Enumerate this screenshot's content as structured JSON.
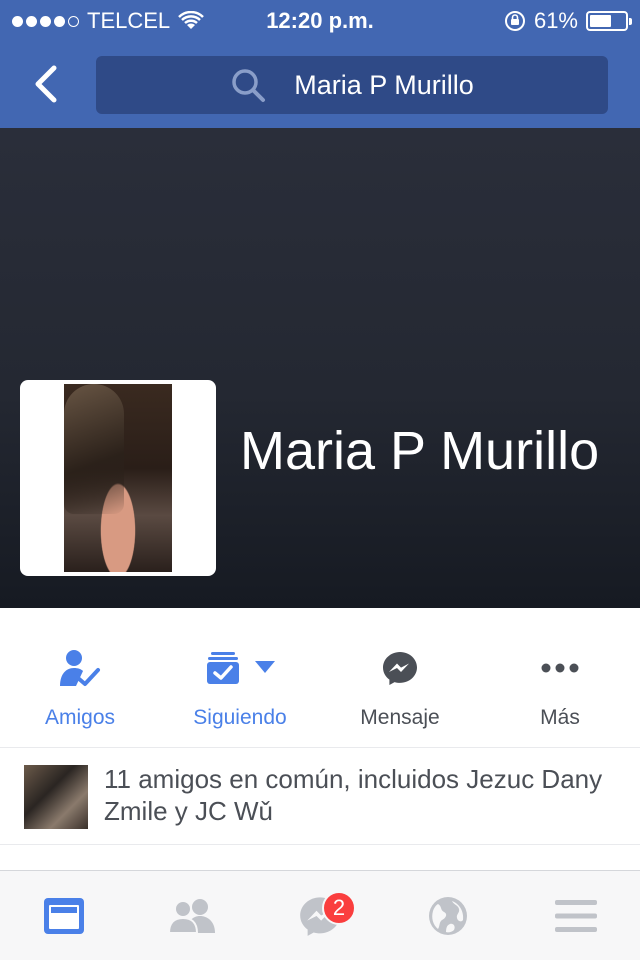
{
  "status_bar": {
    "carrier": "TELCEL",
    "time": "12:20 p.m.",
    "battery": "61%",
    "battery_level": 0.61,
    "signal_bars": 4,
    "signal_max": 5
  },
  "search": {
    "query": "Maria P Murillo"
  },
  "profile": {
    "name": "Maria P Murillo"
  },
  "actions": [
    {
      "label": "Amigos",
      "icon": "friends-check-icon"
    },
    {
      "label": "Siguiendo",
      "icon": "following-icon"
    },
    {
      "label": "Mensaje",
      "icon": "messenger-icon"
    },
    {
      "label": "Más",
      "icon": "more-icon"
    }
  ],
  "mutual_friends": {
    "text": "11 amigos en común, incluidos Jezuc Dany Zmile y JC Wǔ"
  },
  "tab_bar": {
    "tabs": [
      {
        "name": "news-feed",
        "icon": "news-feed-icon",
        "active": true
      },
      {
        "name": "friend-requests",
        "icon": "friends-icon",
        "active": false
      },
      {
        "name": "messenger",
        "icon": "messenger-icon",
        "active": false
      },
      {
        "name": "notifications",
        "icon": "globe-icon",
        "active": false
      },
      {
        "name": "menu",
        "icon": "hamburger-menu-icon",
        "active": false
      }
    ],
    "messenger_badge": "2"
  },
  "colors": {
    "brand": "#4267b2",
    "accent": "#4a80e8",
    "badge": "#fa3e3e",
    "inactive_icon": "#c0c3c9"
  }
}
